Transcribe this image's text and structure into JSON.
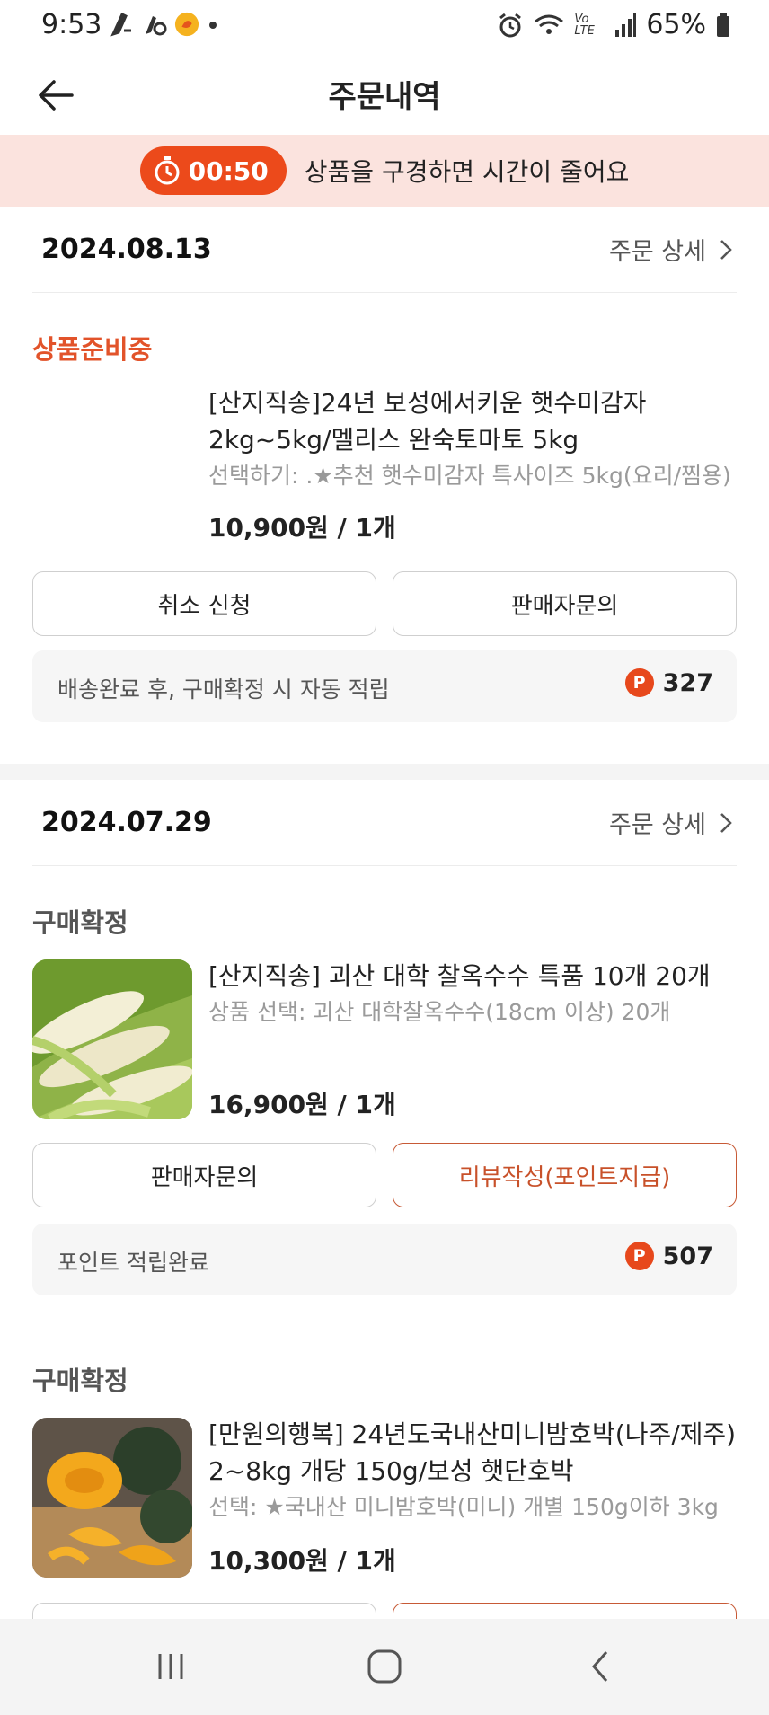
{
  "status_bar": {
    "time": "9:53",
    "left_icons": [
      "notification-icon-1",
      "notification-icon-2",
      "app-notification-icon",
      "dot-icon"
    ],
    "right_icons": [
      "alarm-icon",
      "wifi-icon",
      "volte-icon",
      "signal-icon",
      "battery-icon"
    ],
    "volte_text": "Vo LTE",
    "battery_percent": "65%"
  },
  "header": {
    "title": "주문내역",
    "back_icon": "arrow-left-icon"
  },
  "timer_banner": {
    "time": "00:50",
    "message": "상품을 구경하면 시간이 줄어요",
    "icon": "stopwatch-icon",
    "accent_color": "#ec4a1b",
    "background_color": "#fbe3de"
  },
  "orders": [
    {
      "date": "2024.08.13",
      "detail_label": "주문 상세",
      "items": [
        {
          "status": "상품준비중",
          "title": "[산지직송]24년 보성에서키운 햇수미감자 2kg~5kg/멜리스 완숙토마토 5kg",
          "option": "선택하기: .★추천 햇수미감자 특사이즈 5kg(요리/찜용)",
          "price": "10,900원 / 1개",
          "buttons": [
            "취소 신청",
            "판매자문의"
          ],
          "points_text": "배송완료 후, 구매확정 시 자동 적립",
          "points_value": "327"
        }
      ]
    },
    {
      "date": "2024.07.29",
      "detail_label": "주문 상세",
      "items": [
        {
          "status": "구매확정",
          "title": "[산지직송] 괴산 대학 찰옥수수 특품 10개 20개",
          "option": "상품 선택: 괴산 대학찰옥수수(18cm 이상) 20개",
          "price": "16,900원 / 1개",
          "buttons": [
            "판매자문의",
            "리뷰작성(포인트지급)"
          ],
          "points_text": "포인트 적립완료",
          "points_value": "507"
        },
        {
          "status": "구매확정",
          "title": "[만원의행복] 24년도국내산미니밤호박(나주/제주) 2~8kg 개당 150g/보성 햇단호박",
          "option": "선택: ★국내산 미니밤호박(미니) 개별 150g이하 3kg",
          "price": "10,300원 / 1개"
        }
      ]
    }
  ],
  "bottom_nav": {
    "buttons": [
      "recent-apps-icon",
      "home-icon",
      "back-nav-icon"
    ]
  }
}
